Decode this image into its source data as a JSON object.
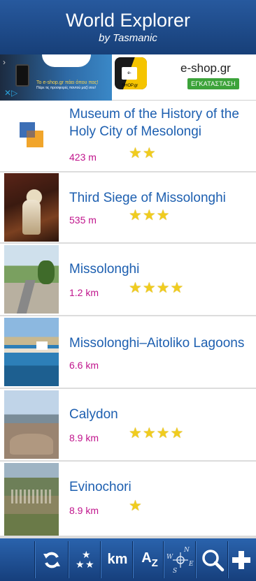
{
  "header": {
    "title": "World Explorer",
    "subtitle": "by Tasmanic"
  },
  "ad": {
    "headline": "Το e-shop.gr πάει όπου πας!",
    "subline": "Πάρε τις προσφορές παντού μαζί σου!",
    "logo_text": "e-SHOP.gr",
    "brand": "e-shop.gr",
    "install_label": "ΕΓΚΑΤΑΣΤΑΣΗ"
  },
  "places": [
    {
      "name": "Museum of the History of the Holy City of Mesolongi",
      "distance": "423 m",
      "rating": 2
    },
    {
      "name": "Third Siege of Missolonghi",
      "distance": "535 m",
      "rating": 3
    },
    {
      "name": "Missolonghi",
      "distance": "1.2 km",
      "rating": 4
    },
    {
      "name": "Missolonghi–Aitoliko Lagoons",
      "distance": "6.6 km",
      "rating": 0
    },
    {
      "name": "Calydon",
      "distance": "8.9 km",
      "rating": 4
    },
    {
      "name": "Evinochori",
      "distance": "8.9 km",
      "rating": 1
    }
  ],
  "toolbar": {
    "km_label": "km",
    "az_label_a": "A",
    "az_label_z": "Z",
    "compass_n": "N",
    "compass_w": "W",
    "compass_e": "E",
    "compass_s": "S",
    "icons": [
      "refresh-icon",
      "rating-sort-icon",
      "distance-unit-icon",
      "alphabetical-sort-icon",
      "compass-icon",
      "search-icon",
      "add-icon"
    ]
  },
  "colors": {
    "header": "#1f4f90",
    "place_name": "#1d5fb0",
    "distance": "#c0148c",
    "star": "#f0cc1e",
    "install": "#3ca33a"
  }
}
